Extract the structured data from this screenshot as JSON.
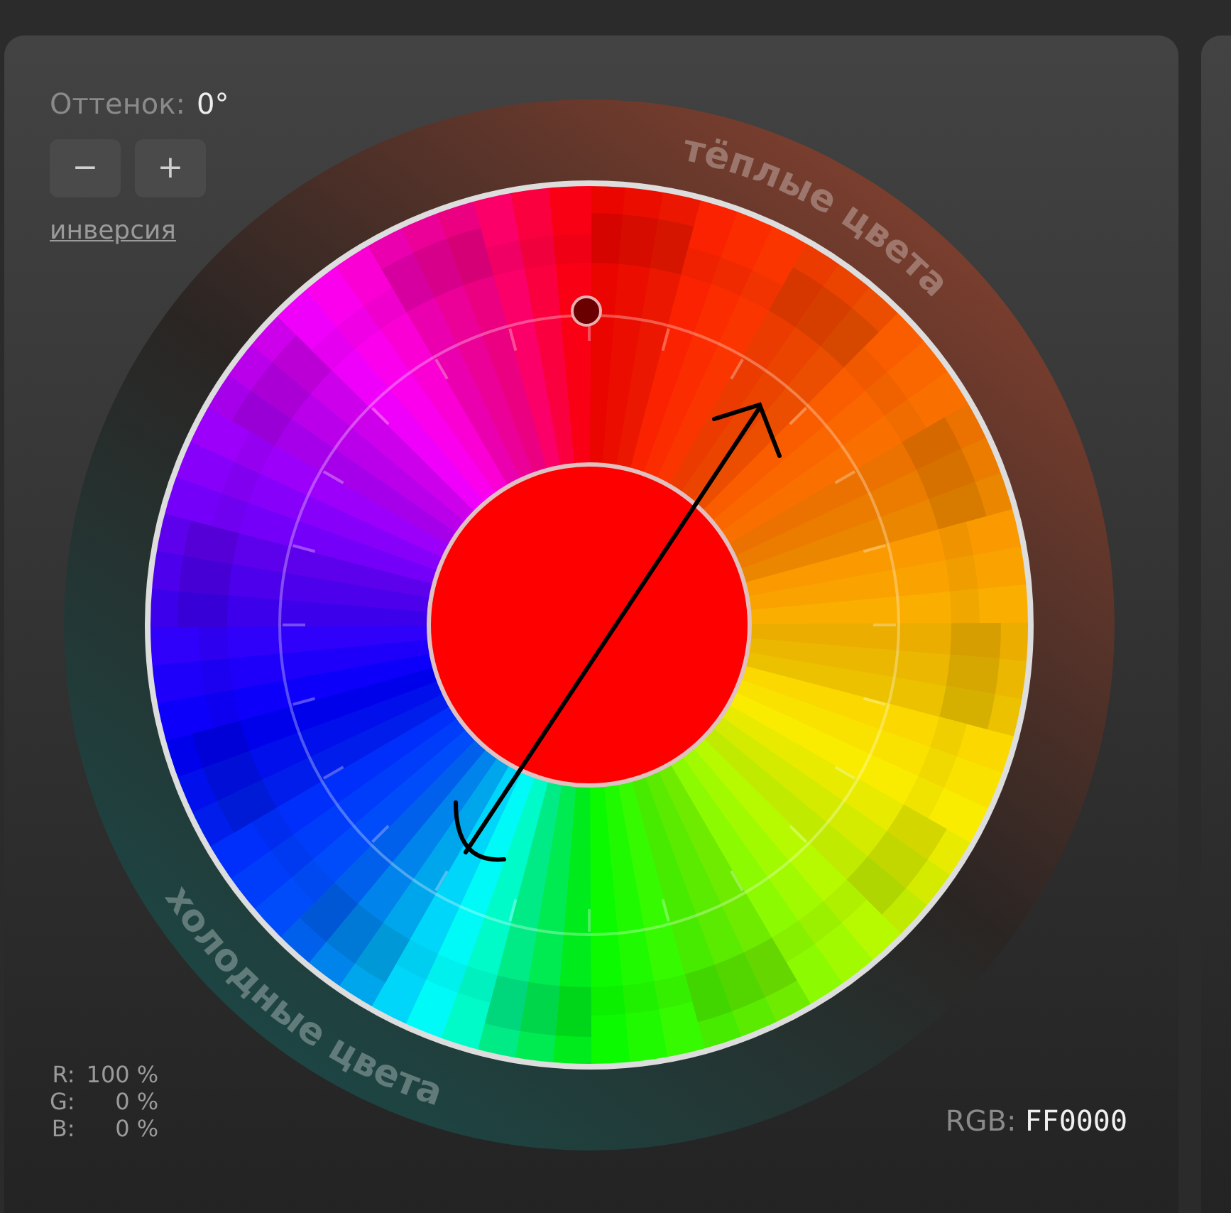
{
  "hue": {
    "label": "Оттенок:",
    "value": "0°"
  },
  "buttons": [
    {
      "label": "−"
    },
    {
      "label": "+"
    }
  ],
  "invert_link": "инверсия",
  "wheel": {
    "warm_label": "тёплые цвета",
    "cold_label": "холодные цвета"
  },
  "rgb_percent": [
    {
      "channel": "R:",
      "value": "100 %"
    },
    {
      "channel": "G:",
      "value": "0 %"
    },
    {
      "channel": "B:",
      "value": "0 %"
    }
  ],
  "rgb_hex": {
    "label": "RGB:",
    "value": "FF0000"
  }
}
